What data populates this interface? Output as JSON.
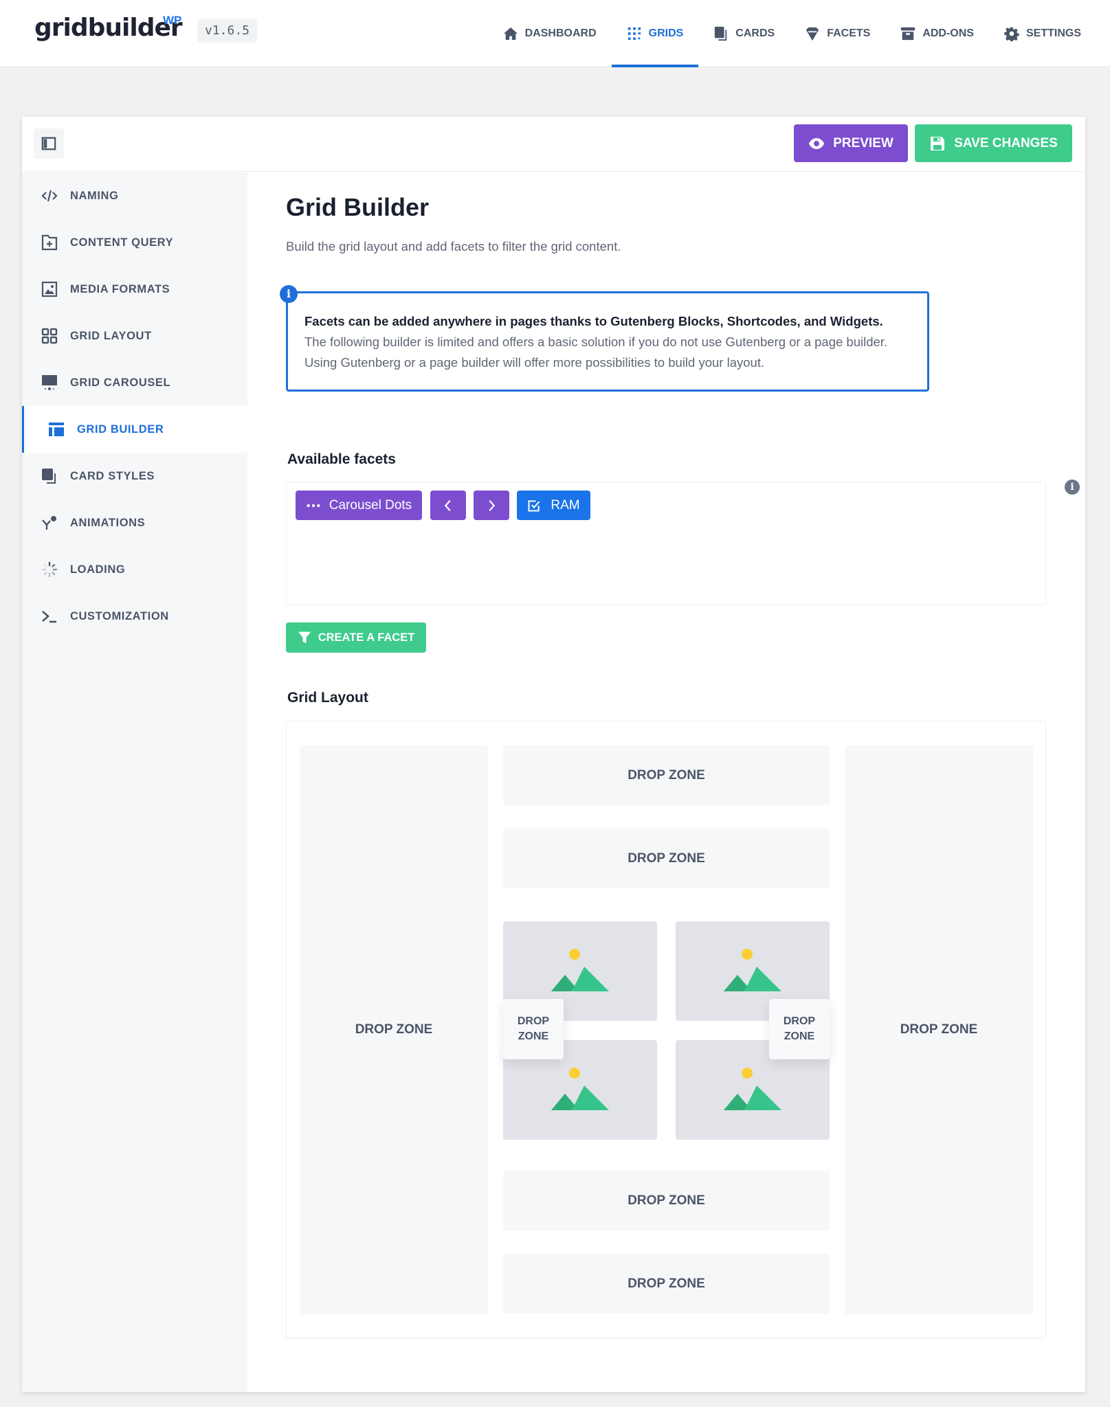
{
  "header": {
    "logo": "gridbuilder",
    "logo_suffix": "WP",
    "version": "v1.6.5",
    "nav": [
      {
        "label": "DASHBOARD",
        "icon": "home-icon",
        "active": false
      },
      {
        "label": "GRIDS",
        "icon": "grid-icon",
        "active": true
      },
      {
        "label": "CARDS",
        "icon": "cards-icon",
        "active": false
      },
      {
        "label": "FACETS",
        "icon": "facet-icon",
        "active": false
      },
      {
        "label": "ADD-ONS",
        "icon": "archive-icon",
        "active": false
      },
      {
        "label": "SETTINGS",
        "icon": "gear-icon",
        "active": false
      }
    ]
  },
  "toolbar": {
    "preview_label": "PREVIEW",
    "save_label": "SAVE CHANGES"
  },
  "sidebar": {
    "items": [
      {
        "label": "NAMING",
        "icon": "code-icon"
      },
      {
        "label": "CONTENT QUERY",
        "icon": "folder-plus-icon"
      },
      {
        "label": "MEDIA FORMATS",
        "icon": "image-icon"
      },
      {
        "label": "GRID LAYOUT",
        "icon": "grid-layout-icon"
      },
      {
        "label": "GRID CAROUSEL",
        "icon": "carousel-icon"
      },
      {
        "label": "GRID BUILDER",
        "icon": "builder-icon",
        "active": true
      },
      {
        "label": "CARD STYLES",
        "icon": "cards-icon"
      },
      {
        "label": "ANIMATIONS",
        "icon": "animation-icon"
      },
      {
        "label": "LOADING",
        "icon": "spinner-icon"
      },
      {
        "label": "CUSTOMIZATION",
        "icon": "terminal-icon"
      }
    ]
  },
  "main": {
    "title": "Grid Builder",
    "subtitle": "Build the grid layout and add facets to filter the grid content.",
    "notice": {
      "bold": "Facets can be added anywhere in pages thanks to Gutenberg Blocks, Shortcodes, and Widgets.",
      "line1": "The following builder is limited and offers a basic solution if you do not use Gutenberg or a page builder.",
      "line2": "Using Gutenberg or a page builder will offer more possibilities to build your layout."
    },
    "available_facets_title": "Available facets",
    "facets": [
      {
        "label": "Carousel Dots",
        "icon": "dots-icon",
        "color": "#7c4ecf"
      },
      {
        "label": "",
        "icon": "chevron-left-icon",
        "color": "#7c4ecf"
      },
      {
        "label": "",
        "icon": "chevron-right-icon",
        "color": "#7c4ecf"
      },
      {
        "label": "RAM",
        "icon": "checkbox-icon",
        "color": "#1a73e8"
      }
    ],
    "create_facet_label": "CREATE A FACET",
    "grid_layout_title": "Grid Layout",
    "drop_zone_label": "DROP ZONE",
    "drop_zone_line1": "DROP",
    "drop_zone_line2": "ZONE"
  },
  "colors": {
    "accent": "#1e6fd9",
    "purple": "#7c4ecf",
    "green": "#3ecb8b",
    "blue_facet": "#1a73e8"
  }
}
